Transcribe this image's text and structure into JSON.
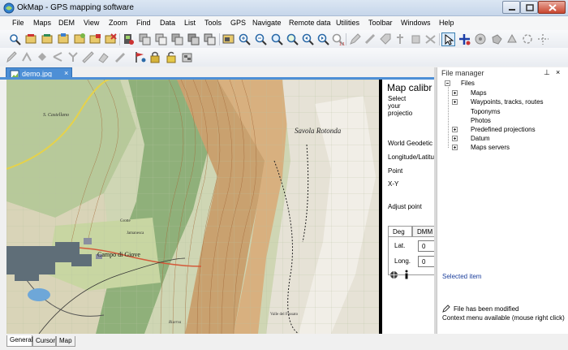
{
  "window": {
    "title": "OkMap - GPS mapping software"
  },
  "menu": [
    "File",
    "Maps",
    "DEM",
    "View",
    "Zoom",
    "Find",
    "Data",
    "List",
    "Tools",
    "GPS",
    "Navigate",
    "Remote data",
    "Utilities",
    "Toolbar",
    "Windows",
    "Help"
  ],
  "toolbar_row1_icons": [
    "open-map-icon",
    "open-dem-icon",
    "open-data-icon",
    "save-icon",
    "save-as-icon",
    "print-icon",
    "close-icon",
    "gps-icon",
    "layers-icon",
    "zoom-in-icon",
    "zoom-out-icon",
    "zoom-window-icon",
    "zoom-fit-icon",
    "zoom-prev-icon",
    "zoom-next-icon",
    "zoom-1-1-icon",
    "select-arrow-icon",
    "add-waypoint-icon",
    "move-icon",
    "hand-icon",
    "drag-icon",
    "rotate-icon"
  ],
  "toolbar_row2_icons": [
    "pencil-icon",
    "route-icon",
    "point-icon",
    "split-icon",
    "join-icon",
    "ruler-icon",
    "eraser-icon",
    "marker-icon",
    "flag-icon",
    "lock-icon",
    "database-icon"
  ],
  "document": {
    "tab_label": "demo.jpg",
    "tab_close": "×"
  },
  "map": {
    "labels": [
      "S. Castellano",
      "Savola Rotonda",
      "Campo di Giove",
      "Grotte",
      "Jamanesca",
      "Valle del Fossato",
      "Riserva"
    ]
  },
  "calibration": {
    "title": "Map calibr",
    "select_lines": [
      "Select",
      "your",
      "projectio"
    ],
    "world_geodetic": "World Geodetic",
    "lon_lat": "Longitude/Latitu",
    "point": "Point",
    "xy": "X-Y",
    "adjust_point": "Adjust point",
    "tabs": [
      "Deg",
      "DMM"
    ],
    "lat_label": "Lat.",
    "long_label": "Long.",
    "lat_value": "0",
    "long_value": "0"
  },
  "file_manager": {
    "title": "File manager",
    "pin": "⊥",
    "close": "×",
    "root": "Files",
    "items": [
      "Maps",
      "Waypoints, tracks, routes",
      "Toponyms",
      "Photos",
      "Predefined projections",
      "Datum",
      "Maps servers"
    ],
    "selected_item_heading": "Selected item",
    "file_modified": "File has been modified",
    "context_menu": "Context menu available (mouse right click)"
  },
  "bottom_tabs": [
    "General",
    "Cursor",
    "Map"
  ],
  "colors": {
    "accent": "#4d8fd6",
    "title_bg": "#c6d6ea",
    "close_red": "#c9462f"
  }
}
